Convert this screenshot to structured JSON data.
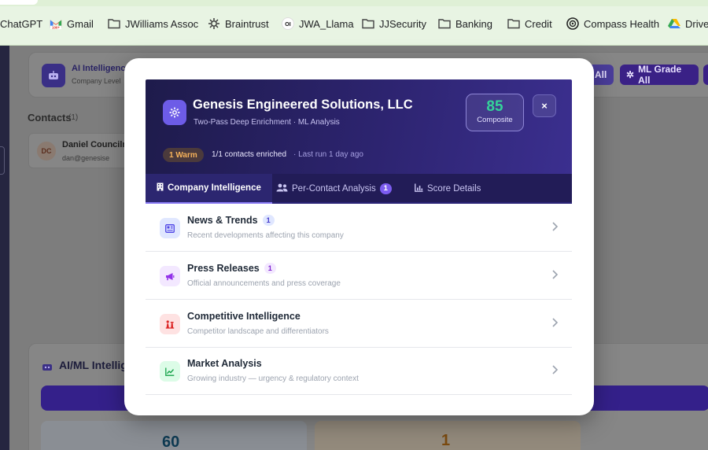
{
  "bookmarks": [
    {
      "label": "ChatGPT",
      "icon": "none"
    },
    {
      "label": "Gmail",
      "icon": "gmail-icon"
    },
    {
      "label": "JWilliams Assoc",
      "icon": "folder-icon"
    },
    {
      "label": "Braintrust",
      "icon": "braintrust-icon"
    },
    {
      "label": "JWA_Llama",
      "icon": "ollama-icon"
    },
    {
      "label": "JJSecurity",
      "icon": "folder-icon"
    },
    {
      "label": "Banking",
      "icon": "folder-icon"
    },
    {
      "label": "Credit",
      "icon": "folder-icon"
    },
    {
      "label": "Compass Health",
      "icon": "compass-icon"
    },
    {
      "label": "Drive",
      "icon": "drive-icon"
    }
  ],
  "background": {
    "panel_title": "AI Intelligenc",
    "panel_subtitle": "Company Level",
    "btn_all": "All",
    "btn_ml_grade": "ML Grade All",
    "contacts_label": "Contacts",
    "contacts_count": "(1)",
    "contact_name": "Daniel Councilm",
    "contact_initials": "DC",
    "contact_email": "dan@genesise",
    "aiml_title": "AI/ML Intellig",
    "stat_left": "60",
    "stat_right": "1"
  },
  "modal": {
    "company_name": "Genesis Engineered Solutions, LLC",
    "subtitle": "Two-Pass Deep Enrichment · ML Analysis",
    "composite_score": "85",
    "composite_label": "Composite",
    "close_label": "×",
    "warm_badge": "1 Warm",
    "enriched_text": "1/1 contacts enriched",
    "last_run_text": "· Last run 1 day ago",
    "tabs": [
      {
        "label": "Company Intelligence",
        "icon": "building-icon",
        "count": ""
      },
      {
        "label": "Per-Contact Analysis",
        "icon": "users-icon",
        "count": "1"
      },
      {
        "label": "Score Details",
        "icon": "chart-icon",
        "count": ""
      }
    ],
    "sections": [
      {
        "title": "News & Trends",
        "badge": "1",
        "desc": "Recent developments affecting this company",
        "icon": "newspaper-icon",
        "icon_bg": "#e0e7ff",
        "icon_color": "#4f46e5"
      },
      {
        "title": "Press Releases",
        "badge": "1",
        "desc": "Official announcements and press coverage",
        "icon": "megaphone-icon",
        "icon_bg": "#f3e8ff",
        "icon_color": "#9333ea"
      },
      {
        "title": "Competitive Intelligence",
        "badge": "",
        "desc": "Competitor landscape and differentiators",
        "icon": "chess-icon",
        "icon_bg": "#fee2e2",
        "icon_color": "#dc2626"
      },
      {
        "title": "Market Analysis",
        "badge": "",
        "desc": "Growing industry — urgency & regulatory context",
        "icon": "trend-icon",
        "icon_bg": "#dcfce7",
        "icon_color": "#16a34a"
      }
    ]
  },
  "colors": {
    "hero_start": "#1e1b4b",
    "hero_end": "#3b2f8f",
    "score_green": "#34d399",
    "warm_orange": "#f6b25a",
    "accent_purple": "#7c5cf0"
  }
}
